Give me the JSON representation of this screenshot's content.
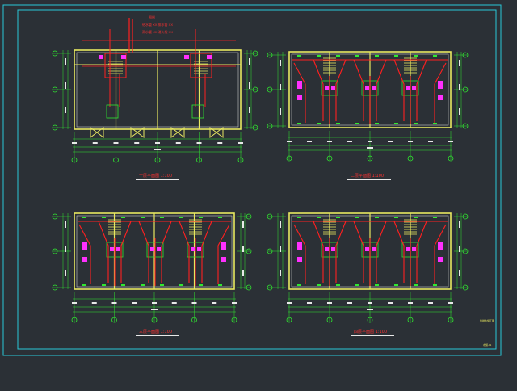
{
  "colors": {
    "background": "#2b3036",
    "frame": "#28c8d8",
    "wall": "#e8e860",
    "grid_green": "#30e830",
    "pipe_red": "#ff2020",
    "fixture_magenta": "#ff30ff",
    "title_red": "#ff3030",
    "dim_white": "#e8e8e8"
  },
  "plans": [
    {
      "id": "plan-1",
      "title": "一层平面图 1:100"
    },
    {
      "id": "plan-2",
      "title": "二层平面图 1:100"
    },
    {
      "id": "plan-3",
      "title": "三层平面图 1:100"
    },
    {
      "id": "plan-4",
      "title": "四层平面图 1:100"
    }
  ],
  "notes": {
    "plan1_legend": [
      "图例",
      "给水管 XX 排水管 XX",
      "雨水管 XX 消火栓 XX"
    ],
    "sheet_code": "给排水施工图",
    "sheet_no": "水施-01"
  }
}
